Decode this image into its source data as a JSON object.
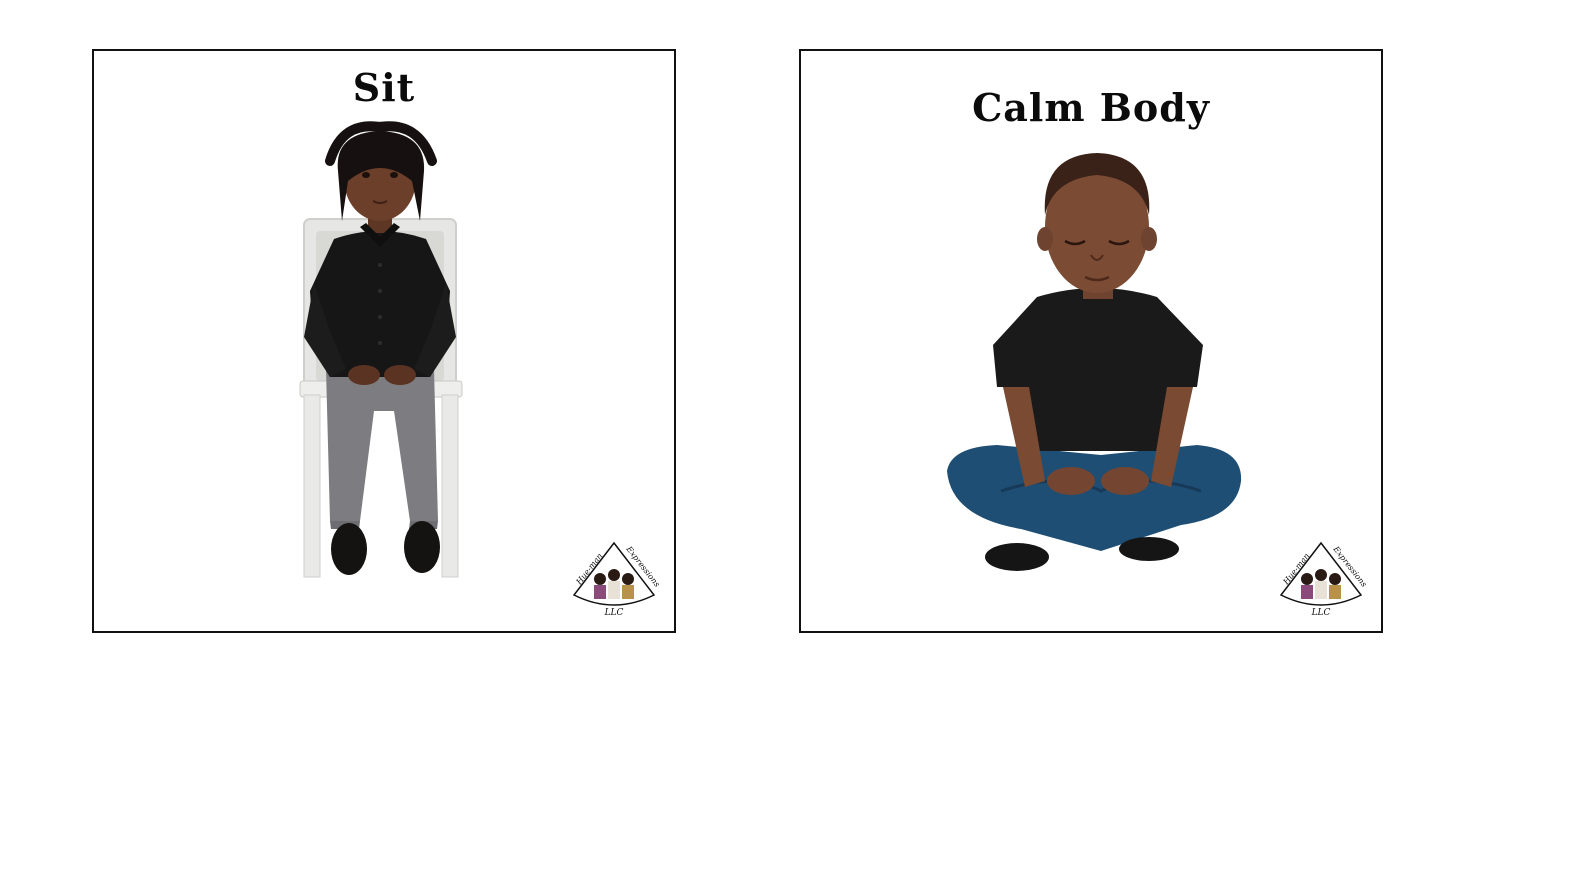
{
  "cards": [
    {
      "title": "Sit",
      "logo": {
        "text_left": "Hue-man",
        "text_right": "Expressions",
        "text_bottom": "LLC"
      }
    },
    {
      "title": "Calm Body",
      "logo": {
        "text_left": "Hue-man",
        "text_right": "Expressions",
        "text_bottom": "LLC"
      }
    }
  ],
  "colors": {
    "shirt": "#161616",
    "pants_sit": "#7d7c80",
    "jeans_calm": "#1f4e74",
    "skin": "#6b3f2a",
    "chair": "#e9e9e7",
    "border": "#111111"
  }
}
